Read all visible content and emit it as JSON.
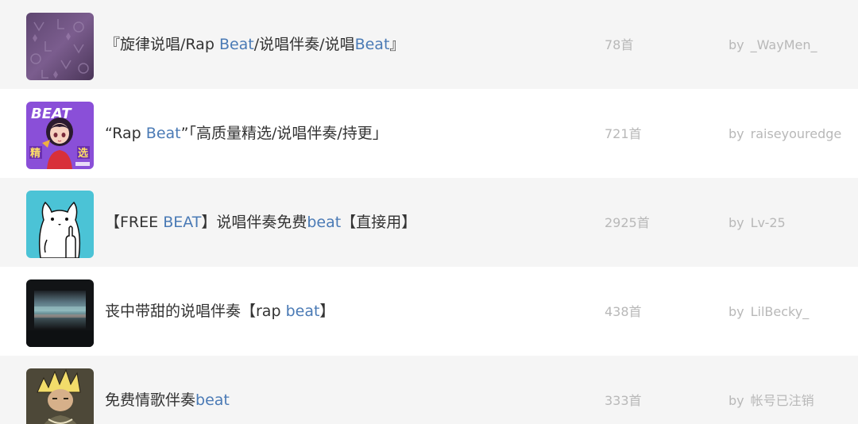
{
  "playlists": [
    {
      "title_segments": [
        {
          "text": "『旋律说唱/Rap ",
          "highlight": false
        },
        {
          "text": "Beat",
          "highlight": true
        },
        {
          "text": "/说唱伴奏/说唱",
          "highlight": false
        },
        {
          "text": "Beat",
          "highlight": true
        },
        {
          "text": "』",
          "highlight": false
        }
      ],
      "count": "78首",
      "by_label": "by",
      "author": "_WayMen_",
      "cover": "purple-monogram-texture"
    },
    {
      "title_segments": [
        {
          "text": "“Rap ",
          "highlight": false
        },
        {
          "text": "Beat",
          "highlight": true
        },
        {
          "text": "”「高质量精选/说唱伴奏/持更」",
          "highlight": false
        }
      ],
      "count": "721首",
      "by_label": "by",
      "author": "raiseyouredge",
      "cover": "beat-anime-girl",
      "cover_text_top": "BEAT",
      "cover_text_left": "精",
      "cover_text_right": "选"
    },
    {
      "title_segments": [
        {
          "text": "【FREE ",
          "highlight": false
        },
        {
          "text": "BEAT",
          "highlight": true
        },
        {
          "text": "】说唱伴奏免费",
          "highlight": false
        },
        {
          "text": "beat",
          "highlight": true
        },
        {
          "text": "【直接用】",
          "highlight": false
        }
      ],
      "count": "2925首",
      "by_label": "by",
      "author": "Lv-25",
      "cover": "white-cat-middle-finger"
    },
    {
      "title_segments": [
        {
          "text": "丧中带甜的说唱伴奏【rap ",
          "highlight": false
        },
        {
          "text": "beat",
          "highlight": true
        },
        {
          "text": "】",
          "highlight": false
        }
      ],
      "count": "438首",
      "by_label": "by",
      "author": "LilBecky_",
      "cover": "dark-beach-photo"
    },
    {
      "title_segments": [
        {
          "text": "免费情歌伴奏",
          "highlight": false
        },
        {
          "text": "beat",
          "highlight": true
        }
      ],
      "count": "333首",
      "by_label": "by",
      "author": "帐号已注销",
      "cover": "blond-rapper-illustration"
    }
  ],
  "colors": {
    "highlight": "#4a7ab5",
    "title": "#333333",
    "meta": "#b8b8b8",
    "row_odd": "#f5f5f5",
    "row_even": "#ffffff"
  }
}
